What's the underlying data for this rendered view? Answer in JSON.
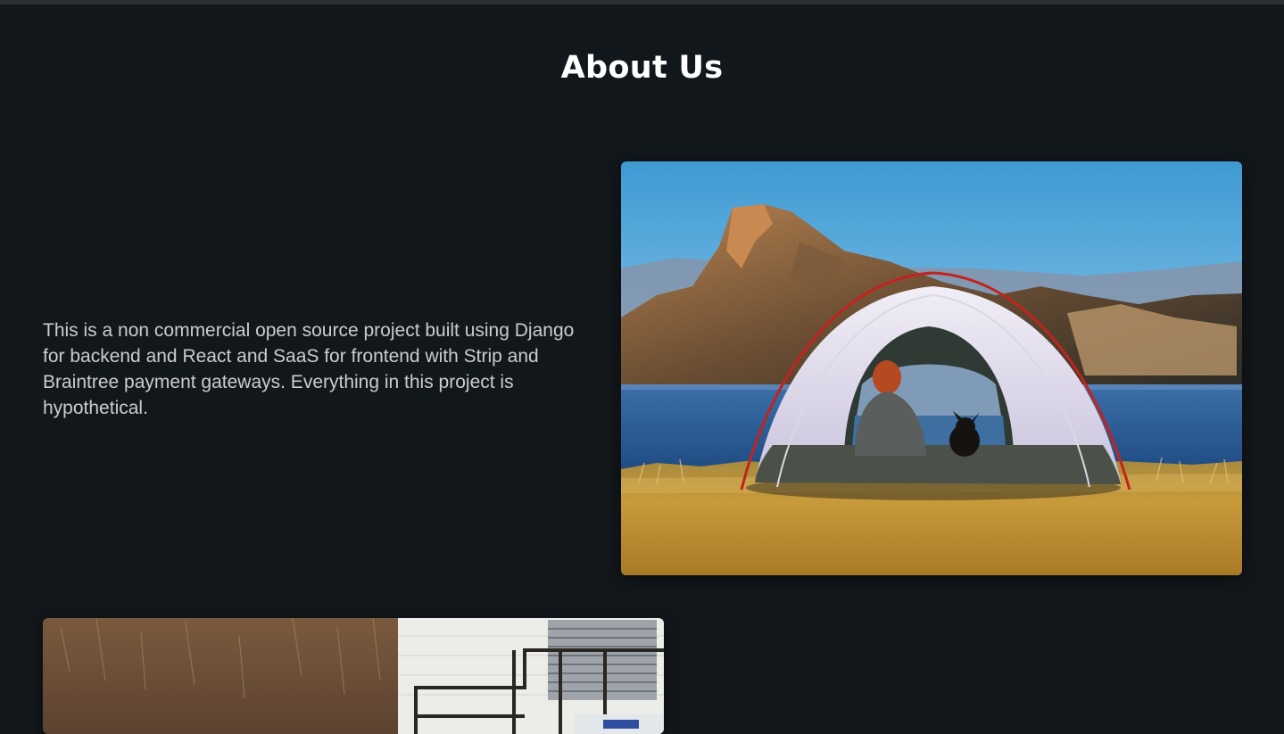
{
  "header": {
    "title": "About Us"
  },
  "about": {
    "description": "This is a non commercial open source project built using Django for backend and React and SaaS for frontend with Strip and Braintree payment gateways. Everything in this project is hypothetical."
  },
  "colors": {
    "background": "#12171b",
    "title": "#ffffff",
    "text": "#c9cdd1"
  }
}
